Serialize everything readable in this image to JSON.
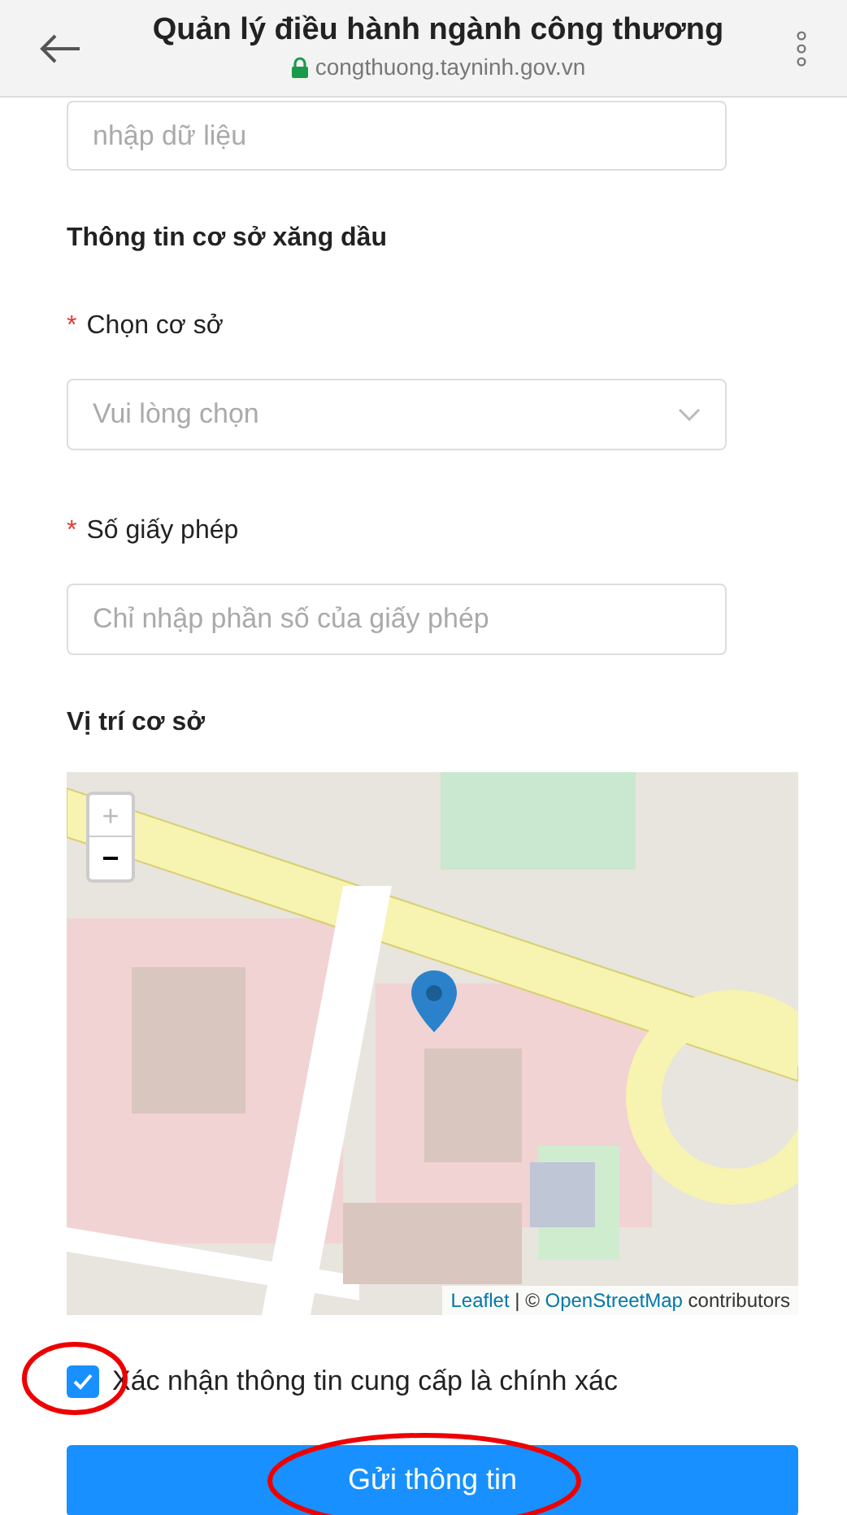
{
  "header": {
    "title": "Quản lý điều hành ngành công thương",
    "url": "congthuong.tayninh.gov.vn"
  },
  "top_field": {
    "placeholder": "nhập dữ liệu"
  },
  "section_title": "Thông tin cơ sở xăng dầu",
  "fields": [
    {
      "kind": "select",
      "required_mark": "*",
      "label": "Chọn cơ sở",
      "placeholder": "Vui lòng chọn"
    },
    {
      "kind": "input",
      "required_mark": "*",
      "label": "Số giấy phép",
      "placeholder": "Chỉ nhập phần số của giấy phép"
    }
  ],
  "map": {
    "label": "Vị trí cơ sở",
    "zoom_in": "+",
    "zoom_out": "−",
    "attribution": {
      "link_1": "Leaflet",
      "separator": " | © ",
      "link_2": "OpenStreetMap",
      "suffix": " contributors"
    }
  },
  "confirm": {
    "label": "Xác nhận thông tin cung cấp là chính xác",
    "checked": true,
    "highlighted": true
  },
  "submit": {
    "label": "Gửi thông tin",
    "highlighted": true
  }
}
